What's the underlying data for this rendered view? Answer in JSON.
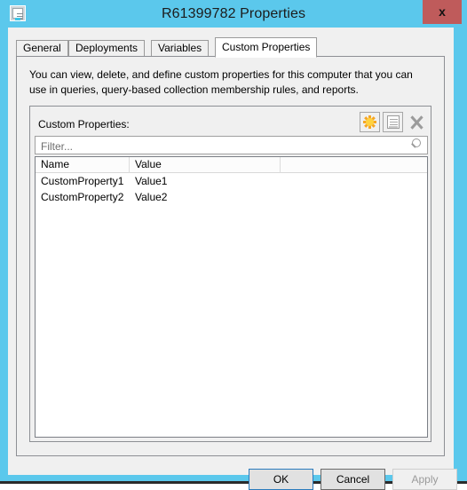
{
  "window": {
    "title": "R61399782 Properties",
    "icon": "properties-document-icon",
    "close_label": "x",
    "chrome_color": "#5BC8EC",
    "close_color": "#bf5b5b"
  },
  "tabs": [
    {
      "label": "General",
      "active": false
    },
    {
      "label": "Deployments",
      "active": false
    },
    {
      "label": "Variables",
      "active": false
    },
    {
      "label": "Custom Properties",
      "active": true
    }
  ],
  "page": {
    "description": "You can view, delete, and define custom properties for this computer that you can use in queries, query-based collection membership rules, and reports.",
    "group_label": "Custom Properties:",
    "toolbar": [
      {
        "name": "new-property-button",
        "icon": "starburst-new-icon",
        "enabled": true,
        "color": "#f5a623"
      },
      {
        "name": "edit-property-button",
        "icon": "properties-document-icon",
        "enabled": false
      },
      {
        "name": "delete-property-button",
        "icon": "x-delete-icon",
        "enabled": false
      }
    ],
    "filter": {
      "value": "",
      "placeholder": "Filter...",
      "icon": "search-magnifier-icon"
    },
    "table": {
      "columns": [
        "Name",
        "Value",
        ""
      ],
      "rows": [
        {
          "name": "CustomProperty1",
          "value": "Value1"
        },
        {
          "name": "CustomProperty2",
          "value": "Value2"
        }
      ]
    }
  },
  "buttons": {
    "ok": "OK",
    "cancel": "Cancel",
    "apply": "Apply",
    "apply_enabled": false
  }
}
